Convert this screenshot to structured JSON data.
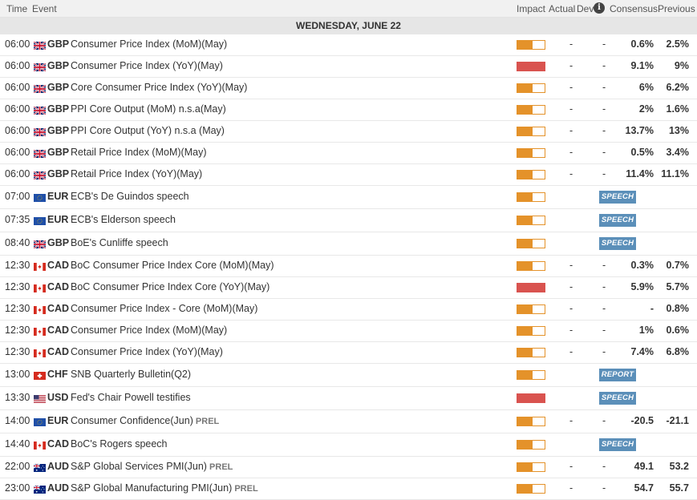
{
  "header": {
    "time": "Time",
    "event": "Event",
    "impact": "Impact",
    "actual": "Actual",
    "dev": "Dev",
    "info_icon": "info-icon",
    "consensus": "Consensus",
    "previous": "Previous"
  },
  "day_label": "WEDNESDAY, JUNE 22",
  "colors": {
    "impact_medium": "#e4922a",
    "impact_high": "#d9534f",
    "tag": "#5b8fb9"
  },
  "events": [
    {
      "time": "06:00",
      "currency": "GBP",
      "flag": "gb-flag",
      "event": "Consumer Price Index (MoM)(May)",
      "impact": "medium",
      "actual": "-",
      "dev": "-",
      "consensus": "0.6%",
      "previous": "2.5%"
    },
    {
      "time": "06:00",
      "currency": "GBP",
      "flag": "gb-flag",
      "event": "Consumer Price Index (YoY)(May)",
      "impact": "high",
      "actual": "-",
      "dev": "-",
      "consensus": "9.1%",
      "previous": "9%"
    },
    {
      "time": "06:00",
      "currency": "GBP",
      "flag": "gb-flag",
      "event": "Core Consumer Price Index (YoY)(May)",
      "impact": "medium",
      "actual": "-",
      "dev": "-",
      "consensus": "6%",
      "previous": "6.2%"
    },
    {
      "time": "06:00",
      "currency": "GBP",
      "flag": "gb-flag",
      "event": "PPI Core Output (MoM) n.s.a(May)",
      "impact": "medium",
      "actual": "-",
      "dev": "-",
      "consensus": "2%",
      "previous": "1.6%"
    },
    {
      "time": "06:00",
      "currency": "GBP",
      "flag": "gb-flag",
      "event": "PPI Core Output (YoY) n.s.a (May)",
      "impact": "medium",
      "actual": "-",
      "dev": "-",
      "consensus": "13.7%",
      "previous": "13%"
    },
    {
      "time": "06:00",
      "currency": "GBP",
      "flag": "gb-flag",
      "event": "Retail Price Index (MoM)(May)",
      "impact": "medium",
      "actual": "-",
      "dev": "-",
      "consensus": "0.5%",
      "previous": "3.4%"
    },
    {
      "time": "06:00",
      "currency": "GBP",
      "flag": "gb-flag",
      "event": "Retail Price Index (YoY)(May)",
      "impact": "medium",
      "actual": "-",
      "dev": "-",
      "consensus": "11.4%",
      "previous": "11.1%"
    },
    {
      "time": "07:00",
      "currency": "EUR",
      "flag": "eu-flag",
      "event": "ECB's De Guindos speech",
      "impact": "medium",
      "tag": "SPEECH"
    },
    {
      "time": "07:35",
      "currency": "EUR",
      "flag": "eu-flag",
      "event": "ECB's Elderson speech",
      "impact": "medium",
      "tag": "SPEECH"
    },
    {
      "time": "08:40",
      "currency": "GBP",
      "flag": "gb-flag",
      "event": "BoE's Cunliffe speech",
      "impact": "medium",
      "tag": "SPEECH"
    },
    {
      "time": "12:30",
      "currency": "CAD",
      "flag": "ca-flag",
      "event": "BoC Consumer Price Index Core (MoM)(May)",
      "impact": "medium",
      "actual": "-",
      "dev": "-",
      "consensus": "0.3%",
      "previous": "0.7%"
    },
    {
      "time": "12:30",
      "currency": "CAD",
      "flag": "ca-flag",
      "event": "BoC Consumer Price Index Core (YoY)(May)",
      "impact": "high",
      "actual": "-",
      "dev": "-",
      "consensus": "5.9%",
      "previous": "5.7%"
    },
    {
      "time": "12:30",
      "currency": "CAD",
      "flag": "ca-flag",
      "event": "Consumer Price Index - Core (MoM)(May)",
      "impact": "medium",
      "actual": "-",
      "dev": "-",
      "consensus": "-",
      "previous": "0.8%"
    },
    {
      "time": "12:30",
      "currency": "CAD",
      "flag": "ca-flag",
      "event": "Consumer Price Index (MoM)(May)",
      "impact": "medium",
      "actual": "-",
      "dev": "-",
      "consensus": "1%",
      "previous": "0.6%"
    },
    {
      "time": "12:30",
      "currency": "CAD",
      "flag": "ca-flag",
      "event": "Consumer Price Index (YoY)(May)",
      "impact": "medium",
      "actual": "-",
      "dev": "-",
      "consensus": "7.4%",
      "previous": "6.8%"
    },
    {
      "time": "13:00",
      "currency": "CHF",
      "flag": "ch-flag",
      "event": "SNB Quarterly Bulletin(Q2)",
      "impact": "medium",
      "tag": "REPORT"
    },
    {
      "time": "13:30",
      "currency": "USD",
      "flag": "us-flag",
      "event": "Fed's Chair Powell testifies",
      "impact": "high",
      "tag": "SPEECH"
    },
    {
      "time": "14:00",
      "currency": "EUR",
      "flag": "eu-flag",
      "event": "Consumer Confidence(Jun)",
      "suffix": "PREL",
      "impact": "medium",
      "actual": "-",
      "dev": "-",
      "consensus": "-20.5",
      "previous": "-21.1"
    },
    {
      "time": "14:40",
      "currency": "CAD",
      "flag": "ca-flag",
      "event": "BoC's Rogers speech",
      "impact": "medium",
      "tag": "SPEECH"
    },
    {
      "time": "22:00",
      "currency": "AUD",
      "flag": "au-flag",
      "event": "S&P Global Services PMI(Jun)",
      "suffix": "PREL",
      "impact": "medium",
      "actual": "-",
      "dev": "-",
      "consensus": "49.1",
      "previous": "53.2"
    },
    {
      "time": "23:00",
      "currency": "AUD",
      "flag": "au-flag",
      "event": "S&P Global Manufacturing PMI(Jun)",
      "suffix": "PREL",
      "impact": "medium",
      "actual": "-",
      "dev": "-",
      "consensus": "54.7",
      "previous": "55.7"
    }
  ]
}
